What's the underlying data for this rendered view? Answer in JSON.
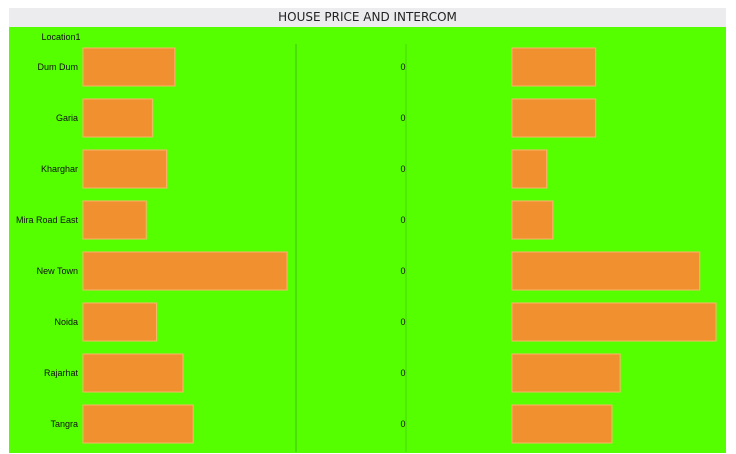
{
  "title": "HOUSE PRICE AND INTERCOM",
  "colors": {
    "background": "#55ff00",
    "bar": "#f0902f",
    "bar_stroke": "#fcb36b",
    "title_bg": "#ececee",
    "divider": "#3fbf10"
  },
  "chart_data": {
    "type": "bar",
    "row_header": "Location1",
    "categories": [
      "Dum Dum",
      "Garia",
      "Kharghar",
      "Mira Road East",
      "New Town",
      "Noida",
      "Rajarhat",
      "Tangra"
    ],
    "series": [
      {
        "values": [
          0.45,
          0.34,
          0.41,
          0.31,
          1.0,
          0.36,
          0.49,
          0.54
        ]
      },
      {
        "values": [
          0,
          0,
          0,
          0,
          0,
          0,
          0,
          0
        ]
      },
      {
        "values": [
          0.41,
          0.41,
          0.17,
          0.2,
          0.92,
          1.0,
          0.53,
          0.49
        ]
      }
    ],
    "xlim": [
      0,
      1
    ]
  }
}
